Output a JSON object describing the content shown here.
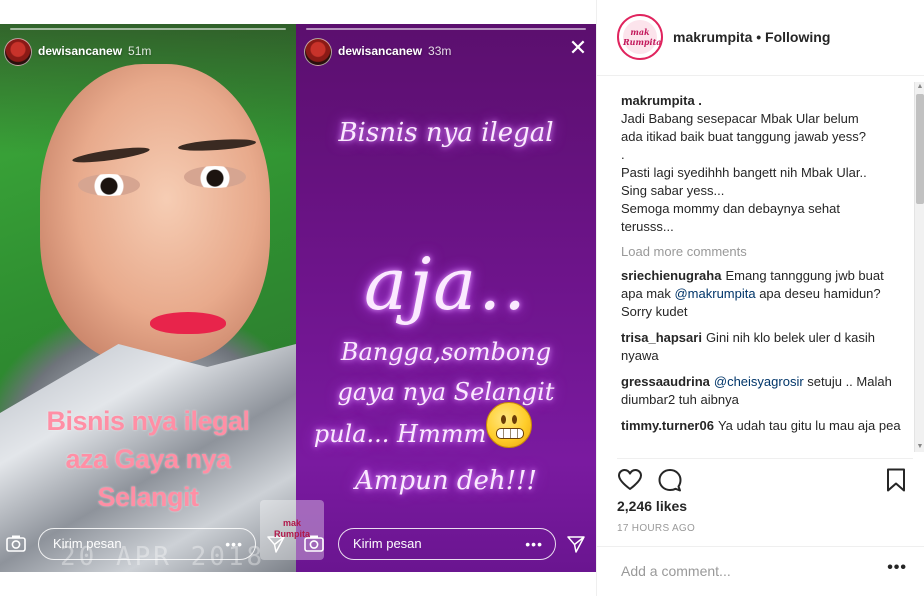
{
  "stories": {
    "left": {
      "username": "dewisancanew",
      "time": "51m",
      "caption_lines": [
        "Bisnis nya ilegal",
        "aza Gaya nya",
        "Selangit"
      ],
      "reply_placeholder": "Kirim pesan",
      "date_stamp": "20 APR 2018",
      "watermark_lines": [
        "mak",
        "Rumpita"
      ]
    },
    "right": {
      "username": "dewisancanew",
      "time": "33m",
      "line1": "Bisnis nya ilegal",
      "big": "aja..",
      "lines": [
        "Bangga,sombong",
        "gaya nya Selangit",
        "pula... Hmmm",
        "Ampun deh!!!"
      ],
      "reply_placeholder": "Kirim pesan"
    }
  },
  "post": {
    "username": "makrumpita",
    "separator": "•",
    "follow_status": "Following",
    "avatar_text": [
      "mak",
      "Rumpita"
    ],
    "caption": {
      "user": "makrumpita .",
      "lines": [
        "Jadi Babang sesepacar Mbak Ular belum",
        "ada itikad baik buat tanggung jawab yess?",
        ".",
        "Pasti lagi syedihhh bangett nih Mbak Ular..",
        "Sing sabar yess...",
        "Semoga mommy dan debaynya sehat",
        "terusss..."
      ]
    },
    "load_more": "Load more comments",
    "comments": [
      {
        "user": "sriechienugraha",
        "pre": "Emang tannggung jwb buat apa mak ",
        "mention": "@makrumpita",
        "post": " apa deseu hamidun? Sorry kudet"
      },
      {
        "user": "trisa_hapsari",
        "pre": "Gini nih klo belek uler d kasih nyawa",
        "mention": "",
        "post": ""
      },
      {
        "user": "gressaaudrina",
        "pre": "",
        "mention": "@cheisyagrosir",
        "post": " setuju .. Malah diumbar2 tuh aibnya"
      },
      {
        "user": "timmy.turner06",
        "pre": "Ya udah tau gitu lu mau aja pea",
        "mention": "",
        "post": ""
      }
    ],
    "likes": "2,246 likes",
    "time_ago": "17 HOURS AGO",
    "add_comment_placeholder": "Add a comment...",
    "more_label": "•••",
    "icons": [
      "heart-icon",
      "comment-icon",
      "bookmark-icon",
      "camera-icon",
      "send-icon",
      "close-icon",
      "more-icon"
    ]
  }
}
